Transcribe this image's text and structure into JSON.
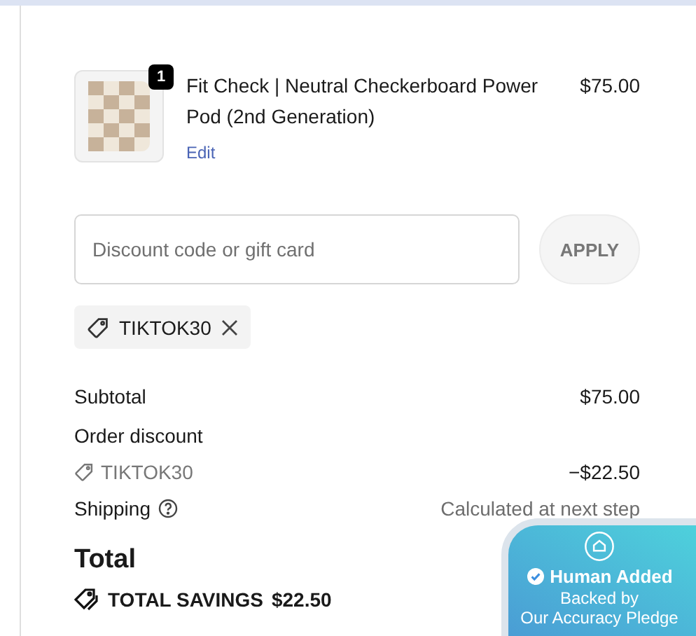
{
  "line_items": [
    {
      "quantity": "1",
      "title": "Fit Check | Neutral Checkerboard Power Pod (2nd Generation)",
      "price": "$75.00",
      "edit_link": "Edit"
    }
  ],
  "discount": {
    "placeholder": "Discount code or gift card",
    "button": "APPLY",
    "applied_codes": [
      {
        "code": "TIKTOK30"
      }
    ]
  },
  "summary": {
    "rows": [
      {
        "kind": "plain",
        "label": "Subtotal",
        "value": "$75.00"
      },
      {
        "kind": "heading",
        "label": "Order discount"
      },
      {
        "kind": "code",
        "label": "TIKTOK30",
        "value": "−$22.50"
      },
      {
        "kind": "help",
        "label": "Shipping",
        "value": "Calculated at next step"
      }
    ],
    "total": {
      "label": "Total"
    },
    "savings": {
      "label": "TOTAL SAVINGS",
      "value": "$22.50"
    }
  },
  "badge": {
    "title": "Human Added",
    "subtitle": "Backed by\nOur Accuracy Pledge"
  }
}
